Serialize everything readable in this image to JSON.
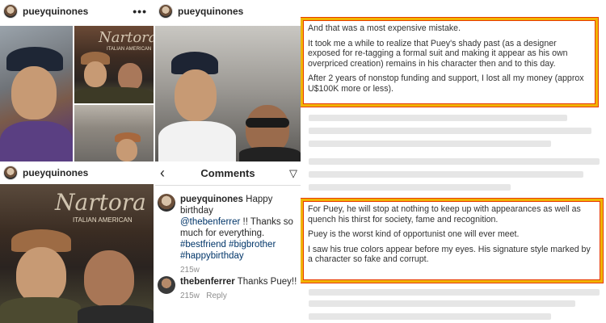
{
  "panels": {
    "top_left": {
      "username": "pueyquinones",
      "more": "•••"
    },
    "top_right": {
      "username": "pueyquinones"
    },
    "bottom_left": {
      "username": "pueyquinones",
      "sign_text": "Nartora",
      "sign_sub": "ITALIAN AMERICAN"
    },
    "grid_sign": {
      "text": "Nartora",
      "sub": "ITALIAN AMERICAN"
    }
  },
  "comments": {
    "title": "Comments",
    "back_glyph": "‹",
    "send_glyph": "▽",
    "items": [
      {
        "username": "pueyquinones",
        "text_prefix": "Happy birthday",
        "mention": "@thebenferrer",
        "text_suffix": " !! Thanks so much for everything.",
        "hashtags": "#bestfriend #bigbrother #happybirthday",
        "time": "215w"
      },
      {
        "username": "thebenferrer",
        "text": "Thanks Puey!!",
        "time": "215w",
        "reply_label": "Reply"
      }
    ]
  },
  "document": {
    "block1": [
      "And that was a most expensive mistake.",
      "It took me a while to realize that Puey's shady past (as a designer exposed for re-tagging a formal suit and making it appear as his own overpriced creation) remains in his character then and to this day.",
      "After 2 years of nonstop funding and support, I lost all my money (approx U$100K more or less)."
    ],
    "block2": [
      "For Puey, he will stop at nothing to keep up with appearances as well as quench his thirst for society, fame and recognition.",
      "Puey is the worst kind of opportunist one will ever meet.",
      "I saw his true colors appear before my eyes. His signature style marked by a character so fake and corrupt."
    ],
    "highlight_colors": {
      "outer": "#f0b400",
      "inner": "#e83a00"
    }
  }
}
